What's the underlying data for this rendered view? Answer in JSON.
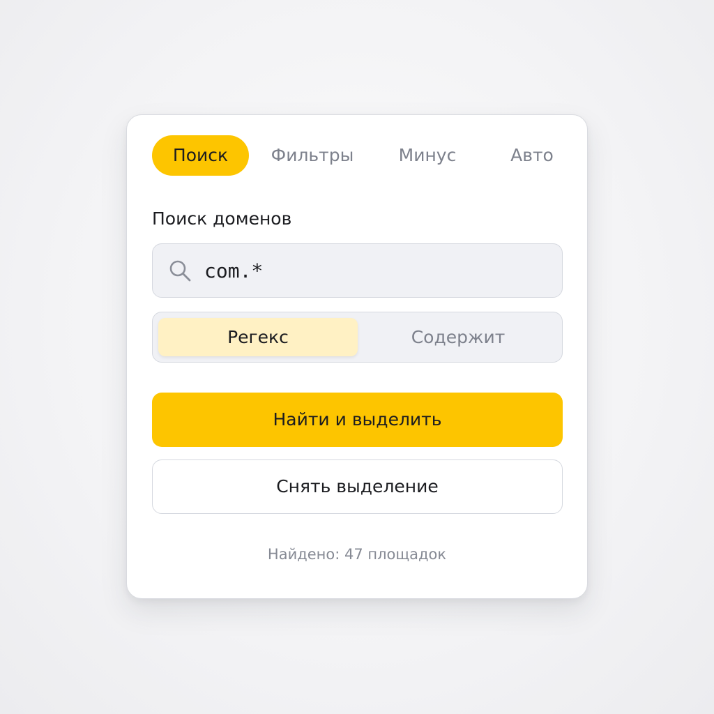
{
  "tabs": [
    {
      "label": "Поиск",
      "active": true
    },
    {
      "label": "Фильтры",
      "active": false
    },
    {
      "label": "Минус",
      "active": false
    },
    {
      "label": "Авто",
      "active": false
    }
  ],
  "search": {
    "label": "Поиск доменов",
    "value": "com.*",
    "icon": "search-icon"
  },
  "mode": {
    "options": [
      {
        "label": "Регекс",
        "active": true
      },
      {
        "label": "Содержит",
        "active": false
      }
    ]
  },
  "actions": {
    "find_label": "Найти и выделить",
    "clear_label": "Снять выделение"
  },
  "result": {
    "text": "Найдено: 47 площадок"
  },
  "colors": {
    "accent": "#fdc500",
    "accent_soft": "#fff1c4",
    "text_primary": "#1b1c20",
    "text_muted": "#7d818c",
    "field_bg": "#f0f1f5"
  }
}
